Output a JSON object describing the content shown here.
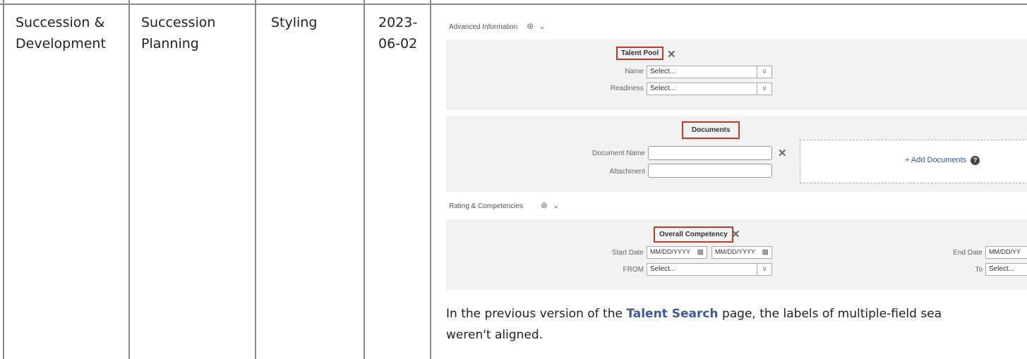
{
  "row": {
    "area": "Succession & Development",
    "feature": "Succession Planning",
    "type": "Styling",
    "date": "2023-06-02"
  },
  "screenshot": {
    "advanced_info": "Advanced Information",
    "talent_pool": {
      "title": "Talent Pool",
      "name_label": "Name",
      "name_value": "Select...",
      "readiness_label": "Readiness",
      "readiness_value": "Select..."
    },
    "documents": {
      "title": "Documents",
      "doc_name_label": "Document Name",
      "attachment_label": "Attachment",
      "add_documents": "+ Add Documents"
    },
    "rating_header": "Rating & Competencies",
    "overall_competency": {
      "title": "Overall Competency",
      "start_date_label": "Start Date",
      "start_date_from": "MM/DD/YYYY",
      "start_date_to": "MM/DD/YYYY",
      "end_date_label": "End Date",
      "end_date_from": "MM/DD/YY",
      "from_label": "FROM",
      "from_value": "Select...",
      "to_label": "To",
      "to_value": "Select..."
    }
  },
  "description": {
    "line1_pre": "In the previous version of the ",
    "link": "Talent Search",
    "line1_post": " page, the labels of multiple-field sea",
    "line2": "weren't aligned."
  }
}
